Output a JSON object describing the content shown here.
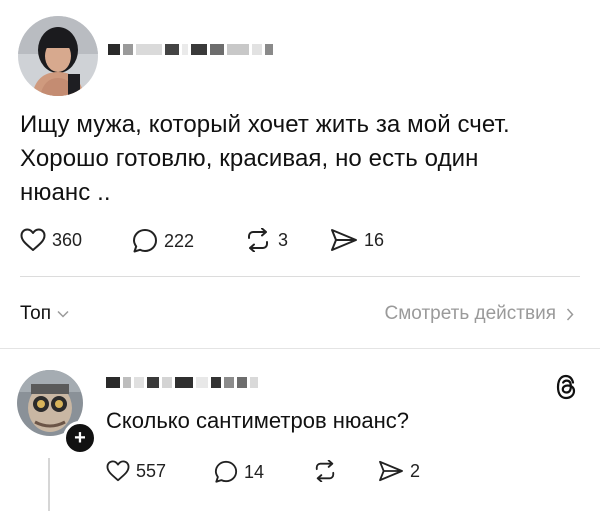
{
  "post": {
    "username": "",
    "text": "Ищу мужа, который хочет жить за мой счет.\nХорошо готовлю, красивая, но есть один\nнюанс ..",
    "stats": {
      "likes": "360",
      "replies": "222",
      "reposts": "3",
      "shares": "16"
    }
  },
  "footer": {
    "sort_label": "Топ",
    "view_activity_label": "Смотреть действия"
  },
  "reply": {
    "username": "",
    "text": "Сколько сантиметров нюанс?",
    "stats": {
      "likes": "557",
      "replies": "14",
      "reposts": "",
      "shares": "2"
    }
  },
  "icons": {
    "like": "heart-icon",
    "reply": "comment-bubble-icon",
    "repost": "repost-icon",
    "share": "share-send-icon",
    "threads": "threads-logo-icon",
    "follow": "plus-icon",
    "chevron_down": "chevron-down-icon",
    "chevron_right": "chevron-right-icon"
  },
  "colors": {
    "text": "#111111",
    "muted": "#9a9a9a",
    "divider": "#dcdcdc"
  }
}
